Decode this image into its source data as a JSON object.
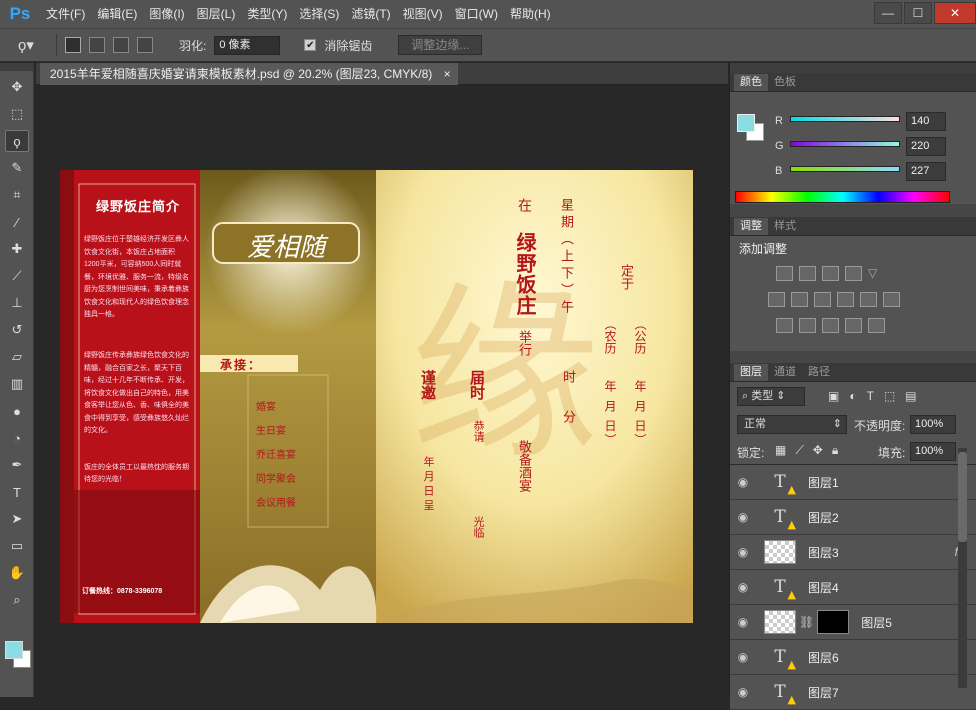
{
  "app": {
    "logo": "Ps",
    "menu": [
      "文件(F)",
      "编辑(E)",
      "图像(I)",
      "图层(L)",
      "类型(Y)",
      "选择(S)",
      "滤镜(T)",
      "视图(V)",
      "窗口(W)",
      "帮助(H)"
    ],
    "window_buttons": [
      "—",
      "☐",
      "✕"
    ]
  },
  "options": {
    "feather_label": "羽化:",
    "feather_value": "0 像素",
    "antialias_label": "消除锯齿",
    "antialias_checked": true,
    "refine_label": "调整边缘..."
  },
  "document": {
    "tab_title": "2015羊年爱相随喜庆婚宴请柬模板素材.psd @ 20.2% (图层23, CMYK/8)",
    "close": "×"
  },
  "invite": {
    "intro_title": "绿野饭庄简介",
    "intro_p1": "绿野饭庄位于楚雄经济开发区彝人饮食文化街，本饭庄占地面积1200平米，可容纳500人同时就餐，环境优雅、服务一流，特级名厨为您烹制世间美味，秉承着彝族饮食文化和现代人的绿色饮食理念独具一格。",
    "intro_p2": "绿野饭庄传承彝族绿色饮食文化的精髓，融合百家之长，聚天下百味，经过十几年不断传承、开发，将饮食文化做出自己的特色，用美食客举让您从色、香、味俱全的美食中得到享受，感受彝族悠久灿烂的文化。",
    "intro_p3": "饭庄的全体员工以最热忱的服务期待您的光临！",
    "hotline": "订餐热线：0878-3396078",
    "logo_text": "爱相随",
    "services_title": "承接：",
    "services": [
      "婚宴",
      "生日宴",
      "乔迁喜宴",
      "同学聚会",
      "会议用餐"
    ],
    "watermark": "缘",
    "col_zai": "在",
    "col_venue": "绿野饭庄",
    "col_juxing": "举行",
    "col_xingqi": "星期（上下）午",
    "col_shi": "时",
    "col_fen": "分",
    "col_jingbei": "敬备酒宴",
    "col_dingyu": "定于",
    "col_nongli": "（农历",
    "col_nongli_ymd": "年  月  日）",
    "col_gongli": "（公历",
    "col_gongli_ymd": "年  月  日）",
    "col_jinyao": "谨邀",
    "col_jieshi": "届时",
    "col_gongqing": "恭请",
    "col_guanglin": "光临",
    "col_nianyueri": "年  月  日  呈"
  },
  "colors": {
    "accent": "#8ce0e5",
    "fg_swatch": "#8cdce3",
    "bg_swatch": "#ffffff",
    "invite_red": "#b4171b"
  },
  "panels": {
    "color": {
      "tabs": [
        "颜色",
        "色板"
      ],
      "channels": [
        {
          "label": "R",
          "value": "140"
        },
        {
          "label": "G",
          "value": "220"
        },
        {
          "label": "B",
          "value": "227"
        }
      ]
    },
    "adjust": {
      "tabs": [
        "调整",
        "样式"
      ],
      "title": "添加调整"
    },
    "layers": {
      "tabs": [
        "图层",
        "通道",
        "路径"
      ],
      "kind": "类型",
      "blend": "正常",
      "opacity_label": "不透明度:",
      "opacity": "100%",
      "lock_label": "锁定:",
      "fill_label": "填充:",
      "fill": "100%",
      "items": [
        {
          "name": "图层1",
          "type": "text"
        },
        {
          "name": "图层2",
          "type": "text"
        },
        {
          "name": "图层3",
          "type": "pixel",
          "fx": "fx"
        },
        {
          "name": "图层4",
          "type": "text"
        },
        {
          "name": "图层5",
          "type": "mask"
        },
        {
          "name": "图层6",
          "type": "text"
        },
        {
          "name": "图层7",
          "type": "text"
        }
      ]
    }
  }
}
